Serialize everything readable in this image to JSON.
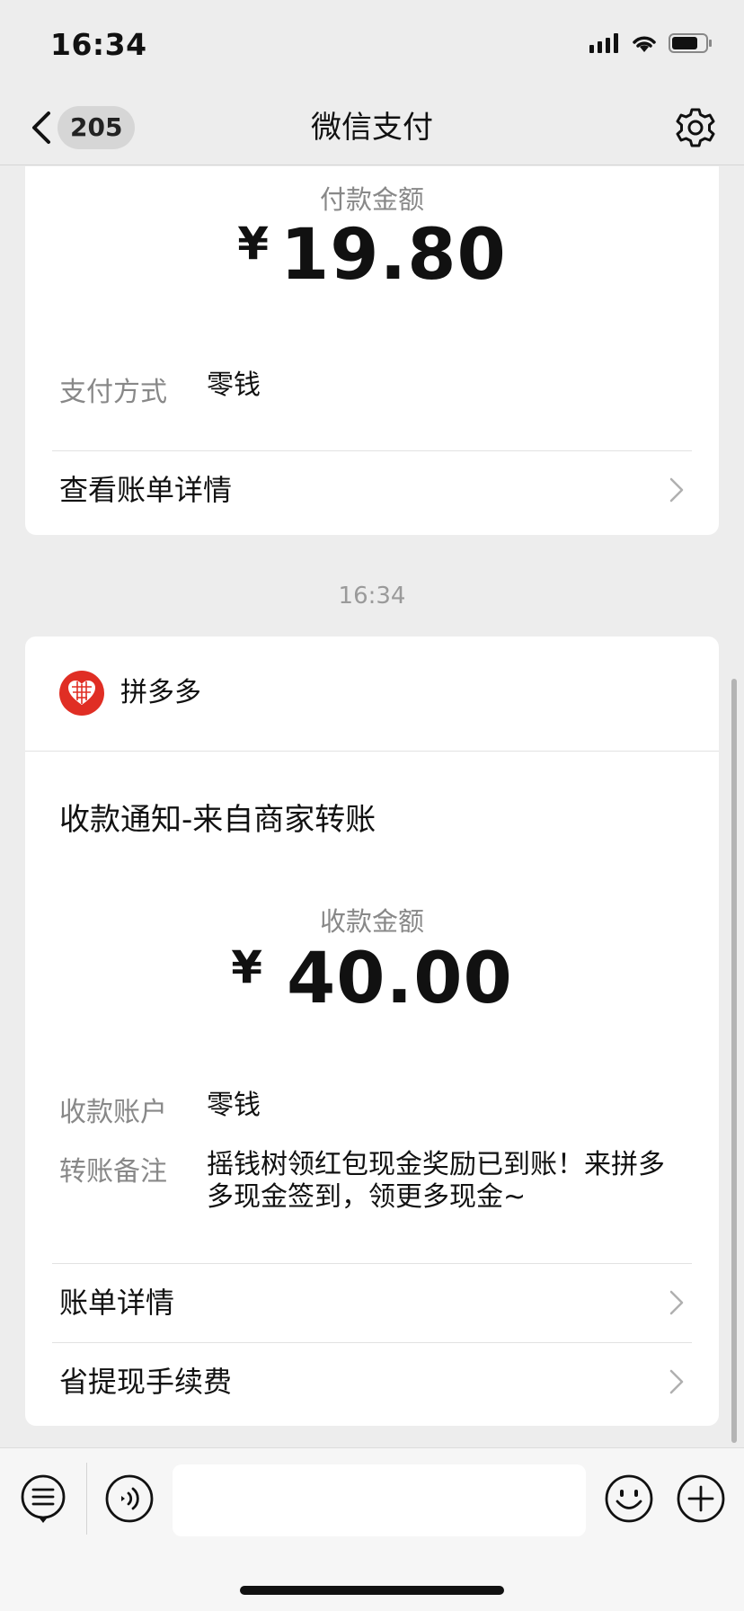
{
  "status_bar": {
    "time": "16:34"
  },
  "nav": {
    "back_badge": "205",
    "title": "微信支付"
  },
  "payment_card": {
    "amount_label": "付款金额",
    "currency": "¥",
    "amount": "19.80",
    "method_label": "支付方式",
    "method_value": "零钱",
    "details_link": "查看账单详情"
  },
  "timestamp": "16:34",
  "receipt_card": {
    "merchant_name": "拼多多",
    "notice_title": "收款通知-来自商家转账",
    "amount_label": "收款金额",
    "currency": "¥",
    "amount": "40.00",
    "account_label": "收款账户",
    "account_value": "零钱",
    "remark_label": "转账备注",
    "remark_value": "摇钱树领红包现金奖励已到账！来拼多多现金签到，领更多现金~",
    "links": [
      {
        "label": "账单详情"
      },
      {
        "label": "省提现手续费"
      }
    ]
  },
  "colors": {
    "page_bg": "#ededed",
    "card_bg": "#ffffff",
    "brand_red": "#e02e24"
  },
  "icons": [
    "back-chevron-icon",
    "gear-icon",
    "chevron-right-icon",
    "pinduoduo-logo",
    "menu-list-icon",
    "voice-icon",
    "emoji-icon",
    "plus-icon"
  ]
}
